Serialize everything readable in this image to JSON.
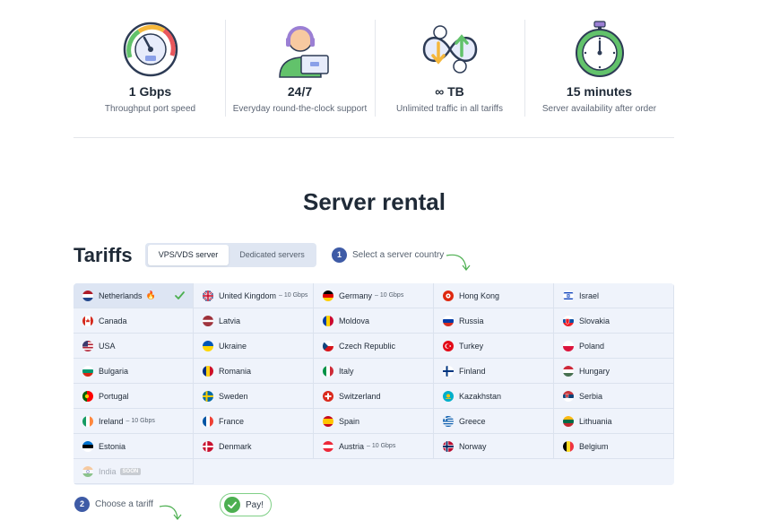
{
  "features": [
    {
      "value": "1 Gbps",
      "desc": "Throughput port speed",
      "icon": "speedometer-icon"
    },
    {
      "value": "24/7",
      "desc": "Everyday round-the-clock support",
      "icon": "support-agent-icon"
    },
    {
      "value": "∞ TB",
      "desc": "Unlimited traffic in all tariffs",
      "icon": "infinite-traffic-icon"
    },
    {
      "value": "15 minutes",
      "desc": "Server availability after order",
      "icon": "stopwatch-icon"
    }
  ],
  "page_title": "Server rental",
  "tariffs_title": "Tariffs",
  "server_type": {
    "active": "VPS/VDS server",
    "inactive": "Dedicated servers"
  },
  "step1": {
    "num": "1",
    "text": "Select a server country"
  },
  "step2": {
    "num": "2",
    "text": "Choose a tariff"
  },
  "countries": [
    {
      "name": "Netherlands",
      "selected": true,
      "hot": true,
      "flag": "nl"
    },
    {
      "name": "United Kingdom",
      "note": "– 10 Gbps",
      "flag": "gb"
    },
    {
      "name": "Germany",
      "note": "– 10 Gbps",
      "flag": "de"
    },
    {
      "name": "Hong Kong",
      "flag": "hk"
    },
    {
      "name": "Israel",
      "flag": "il"
    },
    {
      "name": "Canada",
      "flag": "ca"
    },
    {
      "name": "Latvia",
      "flag": "lv"
    },
    {
      "name": "Moldova",
      "flag": "md"
    },
    {
      "name": "Russia",
      "flag": "ru"
    },
    {
      "name": "Slovakia",
      "flag": "sk"
    },
    {
      "name": "USA",
      "flag": "us"
    },
    {
      "name": "Ukraine",
      "flag": "ua"
    },
    {
      "name": "Czech Republic",
      "flag": "cz"
    },
    {
      "name": "Turkey",
      "flag": "tr"
    },
    {
      "name": "Poland",
      "flag": "pl"
    },
    {
      "name": "Bulgaria",
      "flag": "bg"
    },
    {
      "name": "Romania",
      "flag": "ro"
    },
    {
      "name": "Italy",
      "flag": "it"
    },
    {
      "name": "Finland",
      "flag": "fi"
    },
    {
      "name": "Hungary",
      "flag": "hu"
    },
    {
      "name": "Portugal",
      "flag": "pt"
    },
    {
      "name": "Sweden",
      "flag": "se"
    },
    {
      "name": "Switzerland",
      "flag": "ch"
    },
    {
      "name": "Kazakhstan",
      "flag": "kz"
    },
    {
      "name": "Serbia",
      "flag": "rs"
    },
    {
      "name": "Ireland",
      "note": "– 10 Gbps",
      "flag": "ie"
    },
    {
      "name": "France",
      "flag": "fr"
    },
    {
      "name": "Spain",
      "flag": "es"
    },
    {
      "name": "Greece",
      "flag": "gr"
    },
    {
      "name": "Lithuania",
      "flag": "lt"
    },
    {
      "name": "Estonia",
      "flag": "ee"
    },
    {
      "name": "Denmark",
      "flag": "dk"
    },
    {
      "name": "Austria",
      "note": "– 10 Gbps",
      "flag": "at"
    },
    {
      "name": "Norway",
      "flag": "no"
    },
    {
      "name": "Belgium",
      "flag": "be"
    },
    {
      "name": "India",
      "badge": "SOON",
      "disabled": true,
      "flag": "in"
    }
  ],
  "pay_label": "Pay!",
  "colors": {
    "accent": "#3e5ba6",
    "grid_bg": "#eff3fb",
    "selected_bg": "#dde5f3",
    "green": "#4caf50",
    "fire": "#f08a1c"
  }
}
